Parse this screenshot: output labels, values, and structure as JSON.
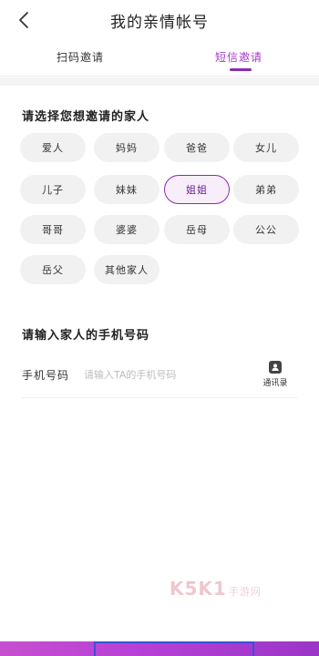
{
  "header": {
    "title": "我的亲情帐号"
  },
  "tabs": [
    {
      "label": "扫码邀请"
    },
    {
      "label": "短信邀请"
    }
  ],
  "section1": {
    "title": "请选择您想邀请的家人"
  },
  "family_options": [
    {
      "label": "爱人"
    },
    {
      "label": "妈妈"
    },
    {
      "label": "爸爸"
    },
    {
      "label": "女儿"
    },
    {
      "label": "儿子"
    },
    {
      "label": "妹妹"
    },
    {
      "label": "姐姐"
    },
    {
      "label": "弟弟"
    },
    {
      "label": "哥哥"
    },
    {
      "label": "婆婆"
    },
    {
      "label": "岳母"
    },
    {
      "label": "公公"
    },
    {
      "label": "岳父"
    },
    {
      "label": "其他家人"
    }
  ],
  "selected_option": "姐姐",
  "section2": {
    "title": "请输入家人的手机号码"
  },
  "phone": {
    "label": "手机号码",
    "placeholder": "请输入TA的手机号码",
    "value": "",
    "contacts_label": "通讯录"
  },
  "watermark": {
    "brand": "K5K1",
    "suffix": "手游网"
  },
  "colors": {
    "accent": "#8a2bb3",
    "bottom_bar": "#b73fd6"
  }
}
